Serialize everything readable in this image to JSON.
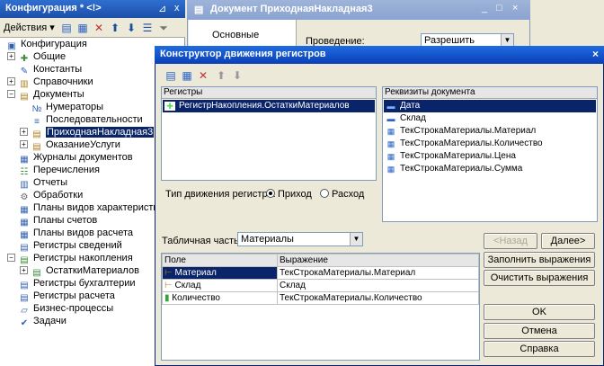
{
  "config": {
    "title": "Конфигурация * <!>",
    "pin": "⊿",
    "close": "x",
    "actions_label": "Действия ▾",
    "tree": [
      {
        "label": "Конфигурация",
        "icon": "config-icon",
        "exp": ""
      },
      {
        "label": "Общие",
        "icon": "common-icon",
        "exp": "+"
      },
      {
        "label": "Константы",
        "icon": "constants-icon",
        "exp": ""
      },
      {
        "label": "Справочники",
        "icon": "catalogs-icon",
        "exp": "+"
      },
      {
        "label": "Документы",
        "icon": "documents-icon",
        "exp": "−"
      },
      {
        "label": "Нумераторы",
        "icon": "numerators-icon",
        "exp": ""
      },
      {
        "label": "Последовательности",
        "icon": "sequences-icon",
        "exp": ""
      },
      {
        "label": "ПриходнаяНакладная3",
        "icon": "document-icon",
        "exp": "+"
      },
      {
        "label": "ОказаниеУслуги",
        "icon": "document-icon",
        "exp": "+"
      },
      {
        "label": "Журналы документов",
        "icon": "journals-icon",
        "exp": ""
      },
      {
        "label": "Перечисления",
        "icon": "enums-icon",
        "exp": ""
      },
      {
        "label": "Отчеты",
        "icon": "reports-icon",
        "exp": ""
      },
      {
        "label": "Обработки",
        "icon": "processing-icon",
        "exp": ""
      },
      {
        "label": "Планы видов характеристик",
        "icon": "plans-icon",
        "exp": ""
      },
      {
        "label": "Планы счетов",
        "icon": "accounts-icon",
        "exp": ""
      },
      {
        "label": "Планы видов расчета",
        "icon": "calc-plans-icon",
        "exp": ""
      },
      {
        "label": "Регистры сведений",
        "icon": "info-registers-icon",
        "exp": ""
      },
      {
        "label": "Регистры накопления",
        "icon": "accum-registers-icon",
        "exp": "−"
      },
      {
        "label": "ОстаткиМатериалов",
        "icon": "register-icon",
        "exp": "+"
      },
      {
        "label": "Регистры бухгалтерии",
        "icon": "acc-registers-icon",
        "exp": ""
      },
      {
        "label": "Регистры расчета",
        "icon": "calc-registers-icon",
        "exp": ""
      },
      {
        "label": "Бизнес-процессы",
        "icon": "bp-icon",
        "exp": ""
      },
      {
        "label": "Задачи",
        "icon": "tasks-icon",
        "exp": ""
      }
    ]
  },
  "doc_window": {
    "title": "Документ ПриходнаяНакладная3",
    "min": "_",
    "max": "□",
    "close": "×",
    "left_tab": "Основные",
    "posting_label": "Проведение:",
    "posting_value": "Разрешить"
  },
  "dialog": {
    "title": "Конструктор движения регистров",
    "close": "×",
    "registers_header": "Регистры",
    "registers": [
      "РегистрНакопления.ОстаткиМатериалов"
    ],
    "attributes_header": "Реквизиты документа",
    "attributes": [
      {
        "label": "Дата",
        "icon": "attr-icon"
      },
      {
        "label": "Склад",
        "icon": "attr-icon"
      },
      {
        "label": "ТекСтрокаМатериалы.Материал",
        "icon": "table-attr-icon"
      },
      {
        "label": "ТекСтрокаМатериалы.Количество",
        "icon": "table-attr-icon"
      },
      {
        "label": "ТекСтрокаМатериалы.Цена",
        "icon": "table-attr-icon"
      },
      {
        "label": "ТекСтрокаМатериалы.Сумма",
        "icon": "table-attr-icon"
      }
    ],
    "movement_type_label": "Тип движения регистра:",
    "movement_income": "Приход",
    "movement_expense": "Расход",
    "table_part_label": "Табличная часть:",
    "table_part_value": "Материалы",
    "grid_headers": [
      "Поле",
      "Выражение"
    ],
    "grid_rows": [
      {
        "field": "Материал",
        "expr": "ТекСтрокаМатериалы.Материал"
      },
      {
        "field": "Склад",
        "expr": "Склад"
      },
      {
        "field": "Количество",
        "expr": "ТекСтрокаМатериалы.Количество"
      }
    ],
    "back_btn": "<Назад",
    "next_btn": "Далее>",
    "fill_btn": "Заполнить выражения",
    "clear_btn": "Очистить выражения",
    "ok_btn": "OK",
    "cancel_btn": "Отмена",
    "help_btn": "Справка"
  }
}
